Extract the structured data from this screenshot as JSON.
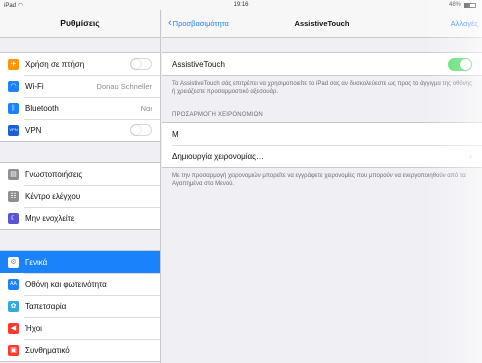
{
  "status_bar": {
    "device": "iPad",
    "wifi_icon": "wifi-icon",
    "time": "19:16",
    "battery": "48%"
  },
  "sidebar": {
    "title": "Ρυθμίσεις",
    "groups": [
      [
        {
          "label": "Χρήση σε πτήση",
          "icon": "airplane-icon",
          "color": "#ff9500",
          "control": "toggle-off"
        },
        {
          "label": "Wi-Fi",
          "value": "Donau Schneller",
          "icon": "wifi-icon",
          "color": "#1a82fb"
        },
        {
          "label": "Bluetooth",
          "value": "Ναι",
          "icon": "bluetooth-icon",
          "color": "#1a82fb"
        },
        {
          "label": "VPN",
          "icon": "vpn-icon",
          "color": "#1a5fd6",
          "control": "toggle-off"
        }
      ],
      [
        {
          "label": "Γνωστοποιήσεις",
          "icon": "notifications-icon",
          "color": "#8e8e93"
        },
        {
          "label": "Κέντρο ελέγχου",
          "icon": "control-center-icon",
          "color": "#8e8e93"
        },
        {
          "label": "Μην ενοχλείτε",
          "icon": "moon-icon",
          "color": "#5856d6"
        }
      ],
      [
        {
          "label": "Γενικά",
          "icon": "gear-icon",
          "color": "#8e8e93",
          "selected": true
        },
        {
          "label": "Οθόνη και φωτεινότητα",
          "icon": "display-icon",
          "color": "#1a82fb"
        },
        {
          "label": "Ταπετσαρία",
          "icon": "wallpaper-icon",
          "color": "#34aadc"
        },
        {
          "label": "Ήχοι",
          "icon": "sounds-icon",
          "color": "#ff3b30"
        },
        {
          "label": "Συνθηματικό",
          "icon": "lock-icon",
          "color": "#ff3b30"
        }
      ]
    ]
  },
  "detail": {
    "back_label": "Προσβασιμότητα",
    "title": "AssistiveTouch",
    "action": "Αλλαγές",
    "toggle_label": "AssistiveTouch",
    "toggle_on": true,
    "toggle_footer": "Το AssistiveTouch σάς επιτρέπει να χρησιμοποιείτε το iPad σας αν δυσκολεύεστε ως προς το άγγιγμα της οθόνης ή χρειάζεστε προσαρμοστικό αξεσουάρ.",
    "section_header": "ΠΡΟΣΑΡΜΟΓΗ ΧΕΙΡΟΝΟΜΙΩΝ",
    "gesture_name": "M",
    "create_label": "Δημιουργία χειρονομίας…",
    "create_footer": "Με την προσαρμογή χειρονομιών μπορείτε να εγγράφετε χειρονομίες που μπορούν να ενεργοποιηθούν από τα Αγαπημένα στο Μενού."
  },
  "colors": {
    "accent": "#1a82fb",
    "toggle_on": "#4cd964",
    "background": "#efeff4"
  }
}
